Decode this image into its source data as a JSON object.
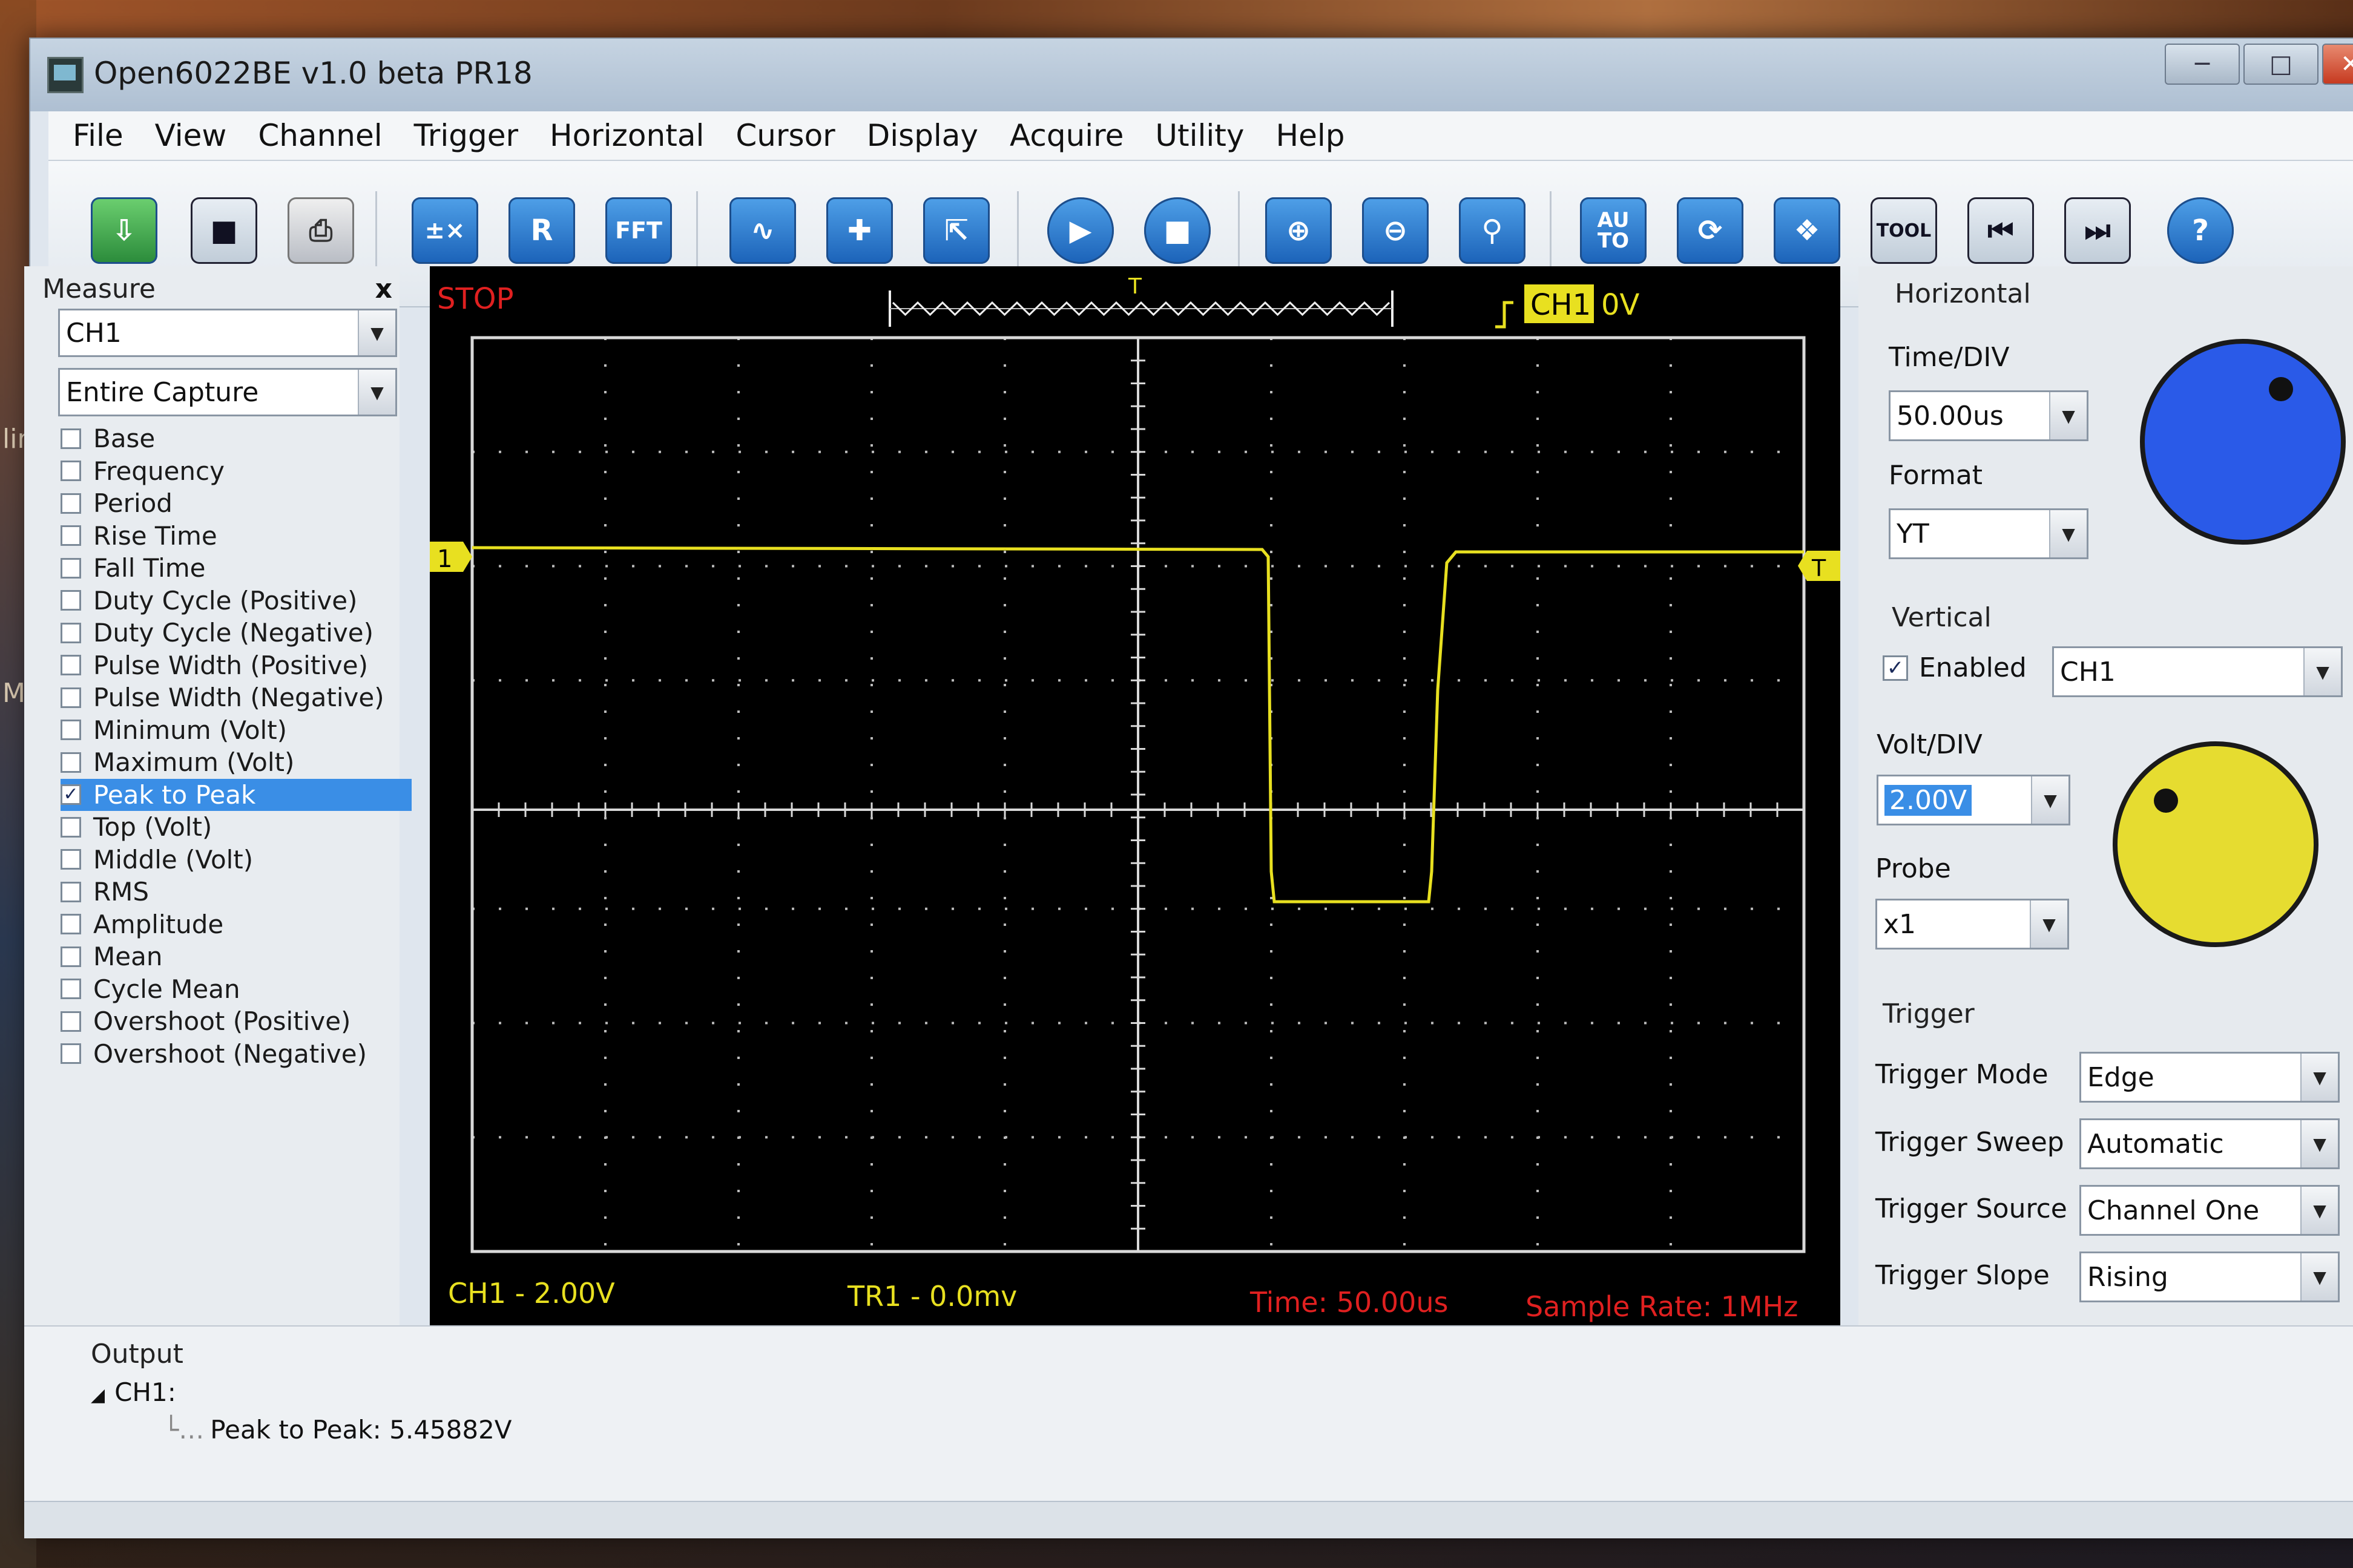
{
  "window": {
    "title": "Open6022BE v1.0 beta PR18"
  },
  "menu": [
    "File",
    "View",
    "Channel",
    "Trigger",
    "Horizontal",
    "Cursor",
    "Display",
    "Acquire",
    "Utility",
    "Help"
  ],
  "toolbar": {
    "r_label": "R",
    "fft_label": "FFT",
    "auto_label": "AU TO",
    "tool_label": "TOOL",
    "help_label": "?"
  },
  "measure": {
    "caption": "Measure",
    "close": "x",
    "channel": "CH1",
    "range": "Entire Capture",
    "items": [
      {
        "label": "Base",
        "checked": false
      },
      {
        "label": "Frequency",
        "checked": false
      },
      {
        "label": "Period",
        "checked": false
      },
      {
        "label": "Rise Time",
        "checked": false
      },
      {
        "label": "Fall Time",
        "checked": false
      },
      {
        "label": "Duty Cycle (Positive)",
        "checked": false
      },
      {
        "label": "Duty Cycle (Negative)",
        "checked": false
      },
      {
        "label": "Pulse Width (Positive)",
        "checked": false
      },
      {
        "label": "Pulse Width (Negative)",
        "checked": false
      },
      {
        "label": "Minimum (Volt)",
        "checked": false
      },
      {
        "label": "Maximum (Volt)",
        "checked": false
      },
      {
        "label": "Peak to Peak",
        "checked": true
      },
      {
        "label": "Top (Volt)",
        "checked": false
      },
      {
        "label": "Middle (Volt)",
        "checked": false
      },
      {
        "label": "RMS",
        "checked": false
      },
      {
        "label": "Amplitude",
        "checked": false
      },
      {
        "label": "Mean",
        "checked": false
      },
      {
        "label": "Cycle Mean",
        "checked": false
      },
      {
        "label": "Overshoot (Positive)",
        "checked": false
      },
      {
        "label": "Overshoot (Negative)",
        "checked": false
      }
    ]
  },
  "scope": {
    "status": "STOP",
    "trigger_channel": "CH1",
    "trigger_level": "0V",
    "ch_marker": "1",
    "trig_marker": "T",
    "top_marker": "T",
    "ch1_scale": "CH1 - 2.00V",
    "tr_label": "TR1 - 0.0mv",
    "time_label": "Time: 50.00us",
    "sample_rate": "Sample Rate: 1MHz",
    "colors": {
      "trace": "#e8e020",
      "status": "#e02020",
      "grid": "#cfcfcf"
    }
  },
  "horizontal": {
    "title": "Horizontal",
    "time_div_label": "Time/DIV",
    "time_div": "50.00us",
    "format_label": "Format",
    "format": "YT",
    "knob_color": "#2a5ae8"
  },
  "vertical": {
    "title": "Vertical",
    "enabled_label": "Enabled",
    "enabled": true,
    "channel": "CH1",
    "volt_div_label": "Volt/DIV",
    "volt_div": "2.00V",
    "probe_label": "Probe",
    "probe": "x1",
    "knob_color": "#e6dc30"
  },
  "trigger": {
    "title": "Trigger",
    "mode_label": "Trigger Mode",
    "mode": "Edge",
    "sweep_label": "Trigger Sweep",
    "sweep": "Automatic",
    "source_label": "Trigger Source",
    "source": "Channel One",
    "slope_label": "Trigger Slope",
    "slope": "Rising"
  },
  "output": {
    "title": "Output",
    "channel": "CH1:",
    "result": "Peak to Peak: 5.45882V"
  },
  "desktop": {
    "left_labels": [
      "lin",
      "Ml"
    ]
  }
}
